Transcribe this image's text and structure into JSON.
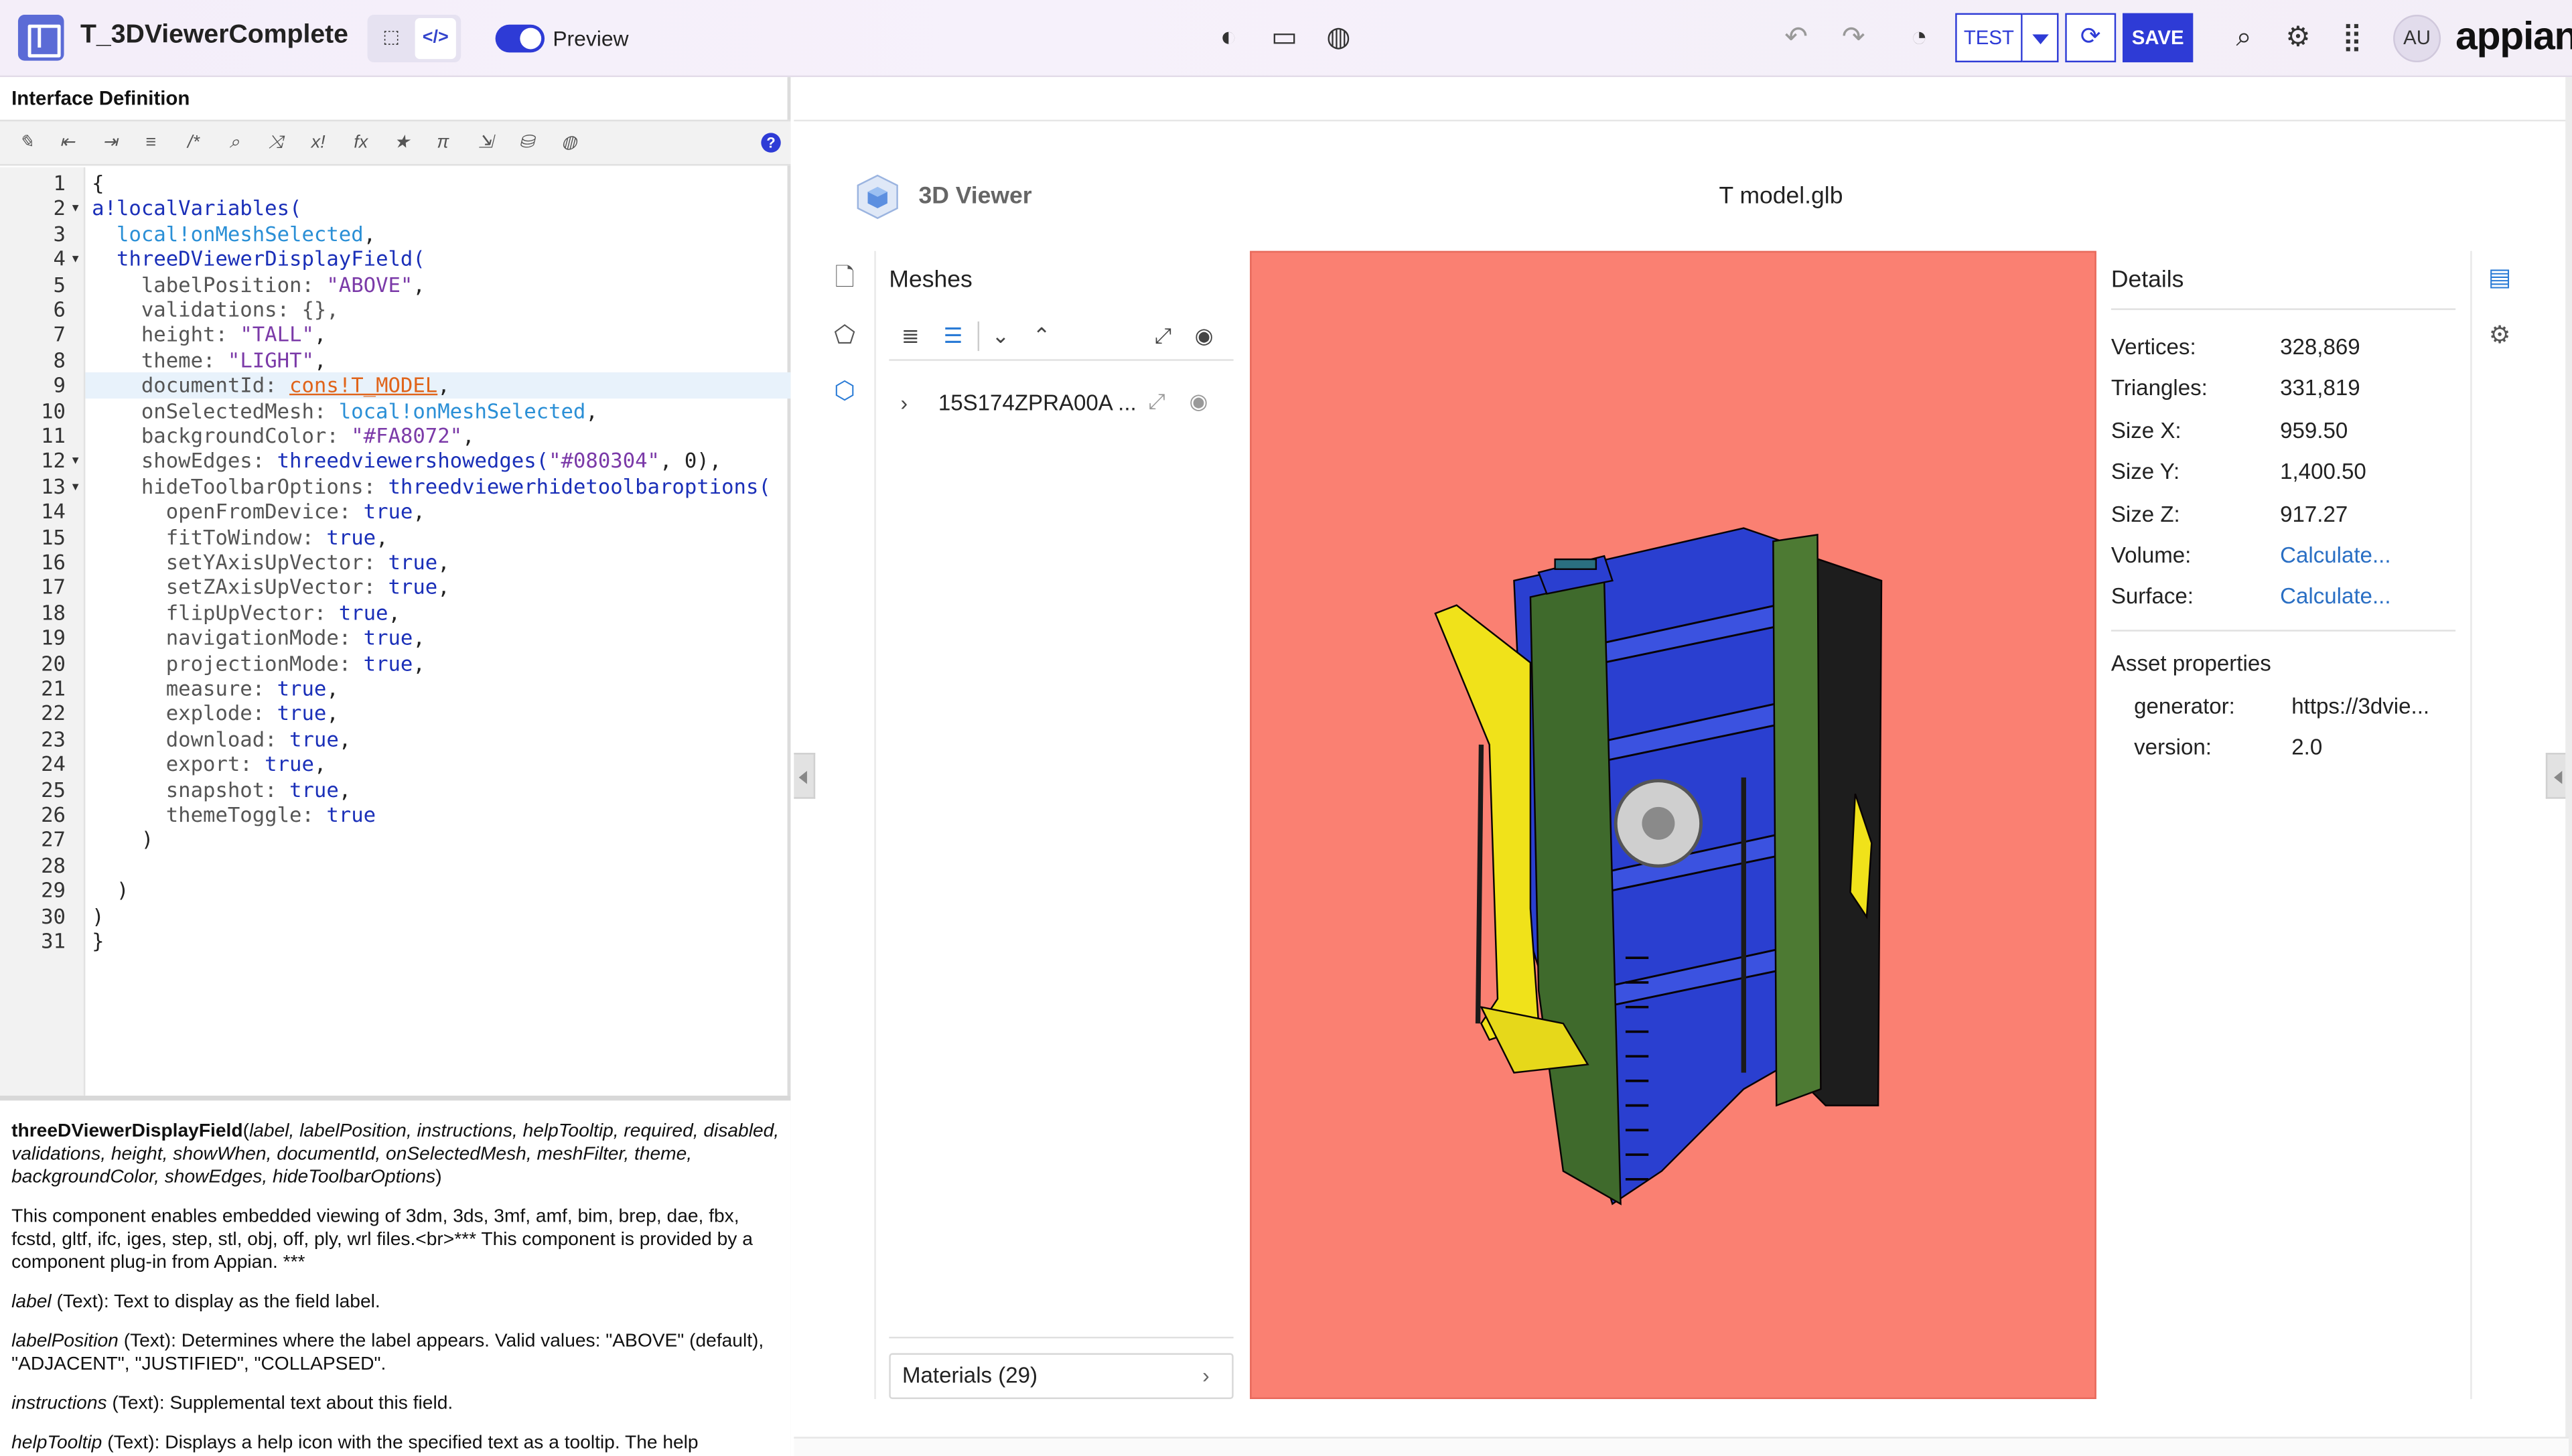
{
  "app": {
    "title": "T_3DViewerComplete",
    "preview_label": "Preview"
  },
  "header": {
    "test_label": "TEST",
    "save_label": "SAVE",
    "avatar_initials": "AU",
    "brand": "appian"
  },
  "left_panel": {
    "title": "Interface Definition",
    "line_numbers": [
      "1",
      "2",
      "3",
      "4",
      "5",
      "6",
      "7",
      "8",
      "9",
      "10",
      "11",
      "12",
      "13",
      "14",
      "15",
      "16",
      "17",
      "18",
      "19",
      "20",
      "21",
      "22",
      "23",
      "24",
      "25",
      "26",
      "27",
      "28",
      "29",
      "30",
      "31"
    ],
    "code": [
      [
        {
          "t": "{",
          "c": "punc"
        }
      ],
      [
        {
          "t": "a!localVariables(",
          "c": "fn"
        }
      ],
      [
        {
          "t": "  ",
          "c": "punc"
        },
        {
          "t": "local!onMeshSelected",
          "c": "var"
        },
        {
          "t": ",",
          "c": "punc"
        }
      ],
      [
        {
          "t": "  ",
          "c": "punc"
        },
        {
          "t": "threeDViewerDisplayField(",
          "c": "fn"
        }
      ],
      [
        {
          "t": "    labelPosition: ",
          "c": "key"
        },
        {
          "t": "\"ABOVE\"",
          "c": "str"
        },
        {
          "t": ",",
          "c": "punc"
        }
      ],
      [
        {
          "t": "    validations: {},",
          "c": "key"
        }
      ],
      [
        {
          "t": "    height: ",
          "c": "key"
        },
        {
          "t": "\"TALL\"",
          "c": "str"
        },
        {
          "t": ",",
          "c": "punc"
        }
      ],
      [
        {
          "t": "    theme: ",
          "c": "key"
        },
        {
          "t": "\"LIGHT\"",
          "c": "str"
        },
        {
          "t": ",",
          "c": "punc"
        }
      ],
      [
        {
          "t": "    documentId: ",
          "c": "key"
        },
        {
          "t": "cons!T_MODEL",
          "c": "const"
        },
        {
          "t": ",",
          "c": "punc"
        }
      ],
      [
        {
          "t": "    onSelectedMesh: ",
          "c": "key"
        },
        {
          "t": "local!onMeshSelected",
          "c": "var"
        },
        {
          "t": ",",
          "c": "punc"
        }
      ],
      [
        {
          "t": "    backgroundColor: ",
          "c": "key"
        },
        {
          "t": "\"#FA8072\"",
          "c": "str"
        },
        {
          "t": ",",
          "c": "punc"
        }
      ],
      [
        {
          "t": "    showEdges: ",
          "c": "key"
        },
        {
          "t": "threedviewershowedges(",
          "c": "fn"
        },
        {
          "t": "\"#080304\"",
          "c": "str"
        },
        {
          "t": ", 0),",
          "c": "punc"
        }
      ],
      [
        {
          "t": "    hideToolbarOptions: ",
          "c": "key"
        },
        {
          "t": "threedviewerhidetoolbaroptions(",
          "c": "fn"
        }
      ],
      [
        {
          "t": "      openFromDevice: ",
          "c": "key"
        },
        {
          "t": "true",
          "c": "kw"
        },
        {
          "t": ",",
          "c": "punc"
        }
      ],
      [
        {
          "t": "      fitToWindow: ",
          "c": "key"
        },
        {
          "t": "true",
          "c": "kw"
        },
        {
          "t": ",",
          "c": "punc"
        }
      ],
      [
        {
          "t": "      setYAxisUpVector: ",
          "c": "key"
        },
        {
          "t": "true",
          "c": "kw"
        },
        {
          "t": ",",
          "c": "punc"
        }
      ],
      [
        {
          "t": "      setZAxisUpVector: ",
          "c": "key"
        },
        {
          "t": "true",
          "c": "kw"
        },
        {
          "t": ",",
          "c": "punc"
        }
      ],
      [
        {
          "t": "      flipUpVector: ",
          "c": "key"
        },
        {
          "t": "true",
          "c": "kw"
        },
        {
          "t": ",",
          "c": "punc"
        }
      ],
      [
        {
          "t": "      navigationMode: ",
          "c": "key"
        },
        {
          "t": "true",
          "c": "kw"
        },
        {
          "t": ",",
          "c": "punc"
        }
      ],
      [
        {
          "t": "      projectionMode: ",
          "c": "key"
        },
        {
          "t": "true",
          "c": "kw"
        },
        {
          "t": ",",
          "c": "punc"
        }
      ],
      [
        {
          "t": "      measure: ",
          "c": "key"
        },
        {
          "t": "true",
          "c": "kw"
        },
        {
          "t": ",",
          "c": "punc"
        }
      ],
      [
        {
          "t": "      explode: ",
          "c": "key"
        },
        {
          "t": "true",
          "c": "kw"
        },
        {
          "t": ",",
          "c": "punc"
        }
      ],
      [
        {
          "t": "      download: ",
          "c": "key"
        },
        {
          "t": "true",
          "c": "kw"
        },
        {
          "t": ",",
          "c": "punc"
        }
      ],
      [
        {
          "t": "      export: ",
          "c": "key"
        },
        {
          "t": "true",
          "c": "kw"
        },
        {
          "t": ",",
          "c": "punc"
        }
      ],
      [
        {
          "t": "      snapshot: ",
          "c": "key"
        },
        {
          "t": "true",
          "c": "kw"
        },
        {
          "t": ",",
          "c": "punc"
        }
      ],
      [
        {
          "t": "      themeToggle: ",
          "c": "key"
        },
        {
          "t": "true",
          "c": "kw"
        }
      ],
      [
        {
          "t": "    )",
          "c": "punc"
        }
      ],
      [
        {
          "t": "",
          "c": "punc"
        }
      ],
      [
        {
          "t": "  )",
          "c": "punc"
        }
      ],
      [
        {
          "t": ")",
          "c": "punc"
        }
      ],
      [
        {
          "t": "}",
          "c": "punc"
        }
      ]
    ],
    "doc": {
      "sig_name": "threeDViewerDisplayField",
      "sig_params": "label, labelPosition, instructions, helpTooltip, required, disabled, validations, height, showWhen, documentId, onSelectedMesh, meshFilter, theme, backgroundColor, showEdges, hideToolbarOptions",
      "description": "This component enables embedded viewing of 3dm, 3ds, 3mf, amf, bim, brep, dae, fbx, fcstd, gltf, ifc, iges, step, stl, obj, off, ply, wrl files.<br>*** This component is provided by a component plug-in from Appian. ***",
      "params": [
        {
          "name": "label",
          "desc": " (Text): Text to display as the field label."
        },
        {
          "name": "labelPosition",
          "desc": " (Text): Determines where the label appears. Valid values: \"ABOVE\" (default), \"ADJACENT\", \"JUSTIFIED\", \"COLLAPSED\"."
        },
        {
          "name": "instructions",
          "desc": " (Text): Supplemental text about this field."
        },
        {
          "name": "helpTooltip",
          "desc": " (Text): Displays a help icon with the specified text as a tooltip. The help"
        }
      ]
    }
  },
  "viewer": {
    "name": "3D Viewer",
    "file_name": "T model.glb",
    "background_color": "#FA8072",
    "meshes_title": "Meshes",
    "mesh_item": "15S174ZPRA00A ...",
    "materials_label": "Materials (29)",
    "details_title": "Details",
    "details": [
      {
        "label": "Vertices:",
        "value": "328,869",
        "link": false
      },
      {
        "label": "Triangles:",
        "value": "331,819",
        "link": false
      },
      {
        "label": "Size X:",
        "value": "959.50",
        "link": false
      },
      {
        "label": "Size Y:",
        "value": "1,400.50",
        "link": false
      },
      {
        "label": "Size Z:",
        "value": "917.27",
        "link": false
      },
      {
        "label": "Volume:",
        "value": "Calculate...",
        "link": true
      },
      {
        "label": "Surface:",
        "value": "Calculate...",
        "link": true
      }
    ],
    "asset_title": "Asset properties",
    "asset": [
      {
        "label": "generator:",
        "value": "https://3dvie...",
        "link": true
      },
      {
        "label": "version:",
        "value": "2.0",
        "link": false
      }
    ]
  },
  "colors": {
    "accent": "#2E3BD6",
    "link": "#2A6FC4",
    "canvas_bg": "#FA8072"
  }
}
